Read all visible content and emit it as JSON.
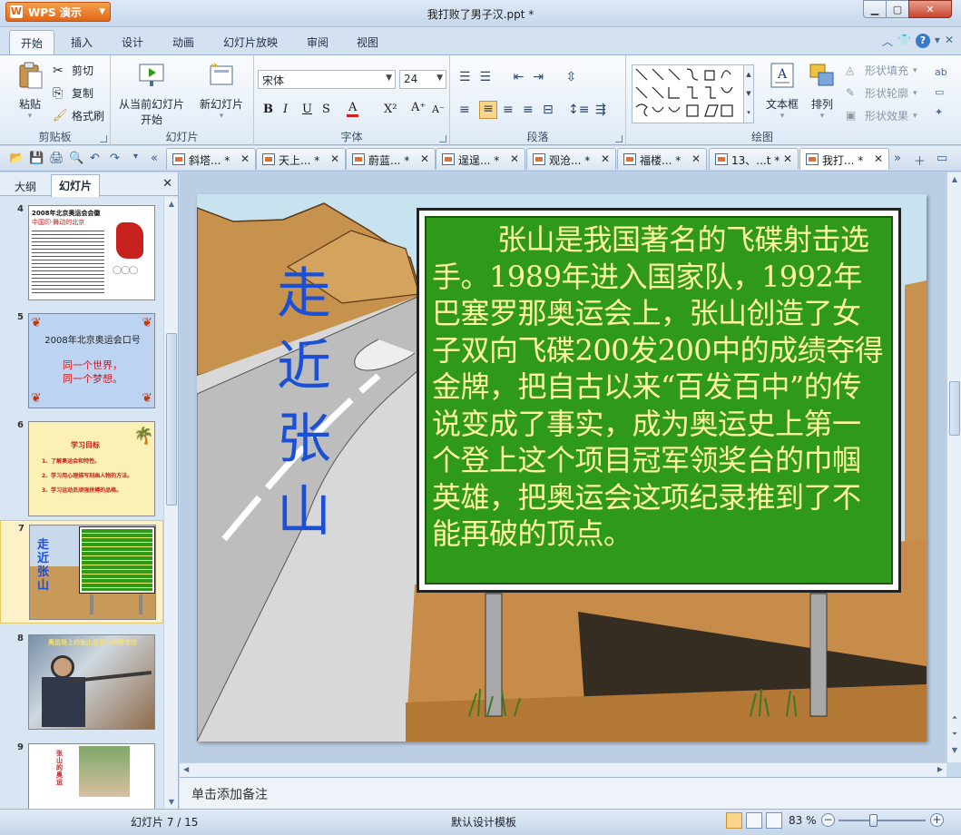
{
  "app": {
    "name": "WPS 演示",
    "doc_title": "我打败了男子汉.ppt *"
  },
  "ribbon_tabs": [
    "开始",
    "插入",
    "设计",
    "动画",
    "幻灯片放映",
    "审阅",
    "视图"
  ],
  "ribbon": {
    "clipboard": {
      "paste": "粘贴",
      "cut": "剪切",
      "copy": "复制",
      "format_painter": "格式刷",
      "label": "剪贴板"
    },
    "slides": {
      "from_current_line1": "从当前幻灯片",
      "from_current_line2": "开始",
      "new_slide": "新幻灯片",
      "label": "幻灯片"
    },
    "font": {
      "name": "宋体",
      "size": "24",
      "label": "字体"
    },
    "paragraph": {
      "label": "段落"
    },
    "drawing": {
      "textbox": "文本框",
      "arrange": "排列",
      "shape_fill": "形状填充",
      "shape_outline": "形状轮廓",
      "shape_effect": "形状效果",
      "label": "绘图"
    }
  },
  "doc_tabs": [
    "斜塔...",
    "天上...",
    "蔚蓝...",
    "逞逞...",
    "观沧...",
    "福楼...",
    "13、...t",
    "我打..."
  ],
  "left_panel": {
    "tabs": [
      "大纲",
      "幻灯片"
    ],
    "slides": [
      {
        "num": "4",
        "title": "2008年北京奥运会会徽",
        "subtitle": "中国印·舞动的北京"
      },
      {
        "num": "5",
        "title": "2008年北京奥运会口号",
        "line1": "同一个世界，",
        "line2": "同一个梦想。"
      },
      {
        "num": "6",
        "title": "学习目标",
        "items": [
          "1、了解奥运会和特性。",
          "2、学习用心理描写刻画人物的方法。",
          "3、学习运动员顽强拼搏的品格。"
        ]
      },
      {
        "num": "7",
        "title": "走近张山"
      },
      {
        "num": "8",
        "title": "奥运场上的张山是那么神情专注"
      },
      {
        "num": "9",
        "title": "张山的奥运"
      }
    ]
  },
  "slide": {
    "title_chars": [
      "走",
      "近",
      "张",
      "山"
    ],
    "body": "张山是我国著名的飞碟射击选手。1989年进入国家队，1992年巴塞罗那奥运会上，张山创造了女子双向飞碟200发200中的成绩夺得金牌，把自古以来“百发百中”的传说变成了事实，成为奥运史上第一个登上这个项目冠军领奖台的巾帼英雄，把奥运会这项纪录推到了不能再破的顶点。"
  },
  "notes_placeholder": "单击添加备注",
  "status": {
    "slide_counter": "幻灯片 7 / 15",
    "template": "默认设计模板",
    "zoom": "83 %",
    "zoom_value": 83
  },
  "colors": {
    "slide_title": "#1a4fd6",
    "board_green": "#2f9a1a",
    "board_text": "#fff8a0",
    "app_orange": "#e0661a"
  }
}
